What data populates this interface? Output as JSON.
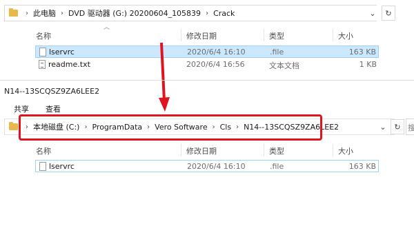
{
  "top_window": {
    "breadcrumb": [
      "此电脑",
      "DVD 驱动器 (G:) 20200604_105839",
      "Crack"
    ],
    "columns": {
      "name": "名称",
      "date": "修改日期",
      "type": "类型",
      "size": "大小"
    },
    "files": [
      {
        "name": "lservrc",
        "date": "2020/6/4 16:10",
        "type": ".file",
        "size": "163 KB",
        "selected": true
      },
      {
        "name": "readme.txt",
        "date": "2020/6/4 16:56",
        "type": "文本文档",
        "size": "1 KB",
        "selected": false
      }
    ]
  },
  "bottom_window": {
    "title": "N14--13SCQSZ9ZA6LEE2",
    "ribbon": [
      "共享",
      "查看"
    ],
    "breadcrumb": [
      "本地磁盘 (C:)",
      "ProgramData",
      "Vero Software",
      "Cls",
      "N14--13SCQSZ9ZA6LEE2"
    ],
    "search_placeholder": "搜",
    "columns": {
      "name": "名称",
      "date": "修改日期",
      "type": "类型",
      "size": "大小"
    },
    "files": [
      {
        "name": "lservrc",
        "date": "2020/6/4 16:10",
        "type": ".file",
        "size": "163 KB"
      }
    ]
  },
  "colors": {
    "highlight": "#e0141e",
    "selection": "#cce8ff",
    "folder": "#e8b94a"
  }
}
